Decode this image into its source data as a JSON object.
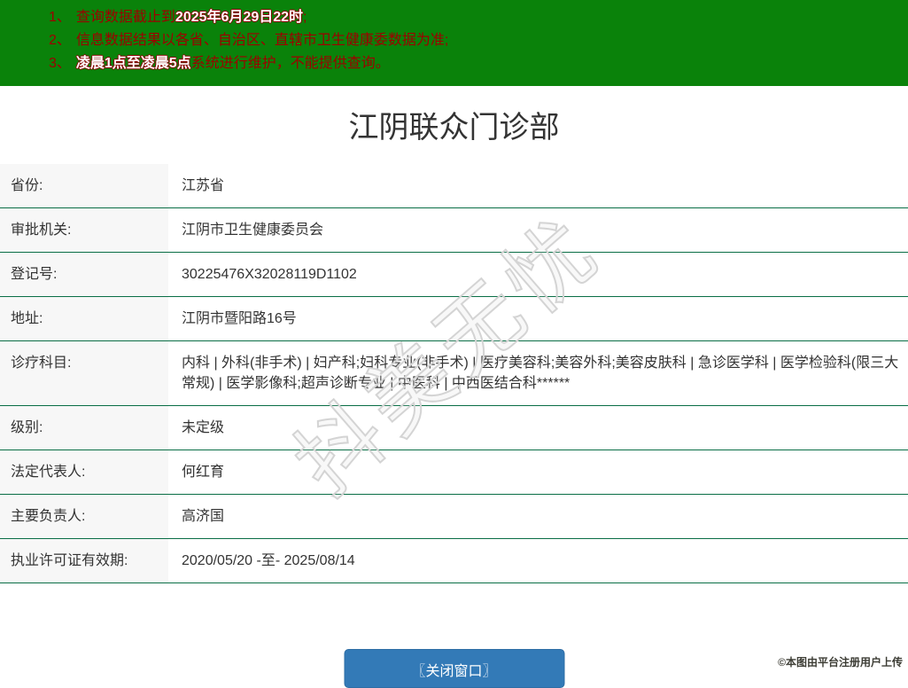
{
  "banner": {
    "lines": [
      {
        "num": "1、",
        "segments": [
          {
            "text": "查询数据截止到",
            "bold": false
          },
          {
            "text": "2025年6月29日22时",
            "bold": true
          },
          {
            "text": ";",
            "bold": false
          }
        ]
      },
      {
        "num": "2、",
        "segments": [
          {
            "text": "信息数据结果以各省、自治区、直辖市卫生健康委数据为准;",
            "bold": false
          }
        ]
      },
      {
        "num": "3、",
        "segments": [
          {
            "text": "凌晨1点至凌晨5点",
            "bold": true
          },
          {
            "text": "系统进行维护，不能提供查询。",
            "bold": false
          }
        ]
      }
    ]
  },
  "title": "江阴联众门诊部",
  "table": {
    "rows": [
      {
        "label": "省份:",
        "value": "江苏省"
      },
      {
        "label": "审批机关:",
        "value": "江阴市卫生健康委员会"
      },
      {
        "label": "登记号:",
        "value": "30225476X32028119D1102"
      },
      {
        "label": "地址:",
        "value": "江阴市暨阳路16号"
      },
      {
        "label": "诊疗科目:",
        "value": "内科 | 外科(非手术) | 妇产科;妇科专业(非手术) | 医疗美容科;美容外科;美容皮肤科 | 急诊医学科 | 医学检验科(限三大常规) | 医学影像科;超声诊断专业 | 中医科 | 中西医结合科******"
      },
      {
        "label": "级别:",
        "value": "未定级"
      },
      {
        "label": "法定代表人:",
        "value": "何红育"
      },
      {
        "label": "主要负责人:",
        "value": "高济国"
      },
      {
        "label": "执业许可证有效期:",
        "value": "2020/05/20 -至- 2025/08/14"
      }
    ]
  },
  "close_button": {
    "label": "〖关闭窗口〗"
  },
  "watermarks": {
    "center": "抖美无忧",
    "uploader": "©本图由平台注册用户上传"
  },
  "colors": {
    "banner_green": "#0a820a",
    "banner_text_red": "#9d0000",
    "banner_highlight": "#ffffff",
    "table_border_green": "#0a6e46",
    "label_cell_bg": "#f7f7f7",
    "button_blue": "#337ab7",
    "watermark_gray": "#d4d4d4"
  }
}
